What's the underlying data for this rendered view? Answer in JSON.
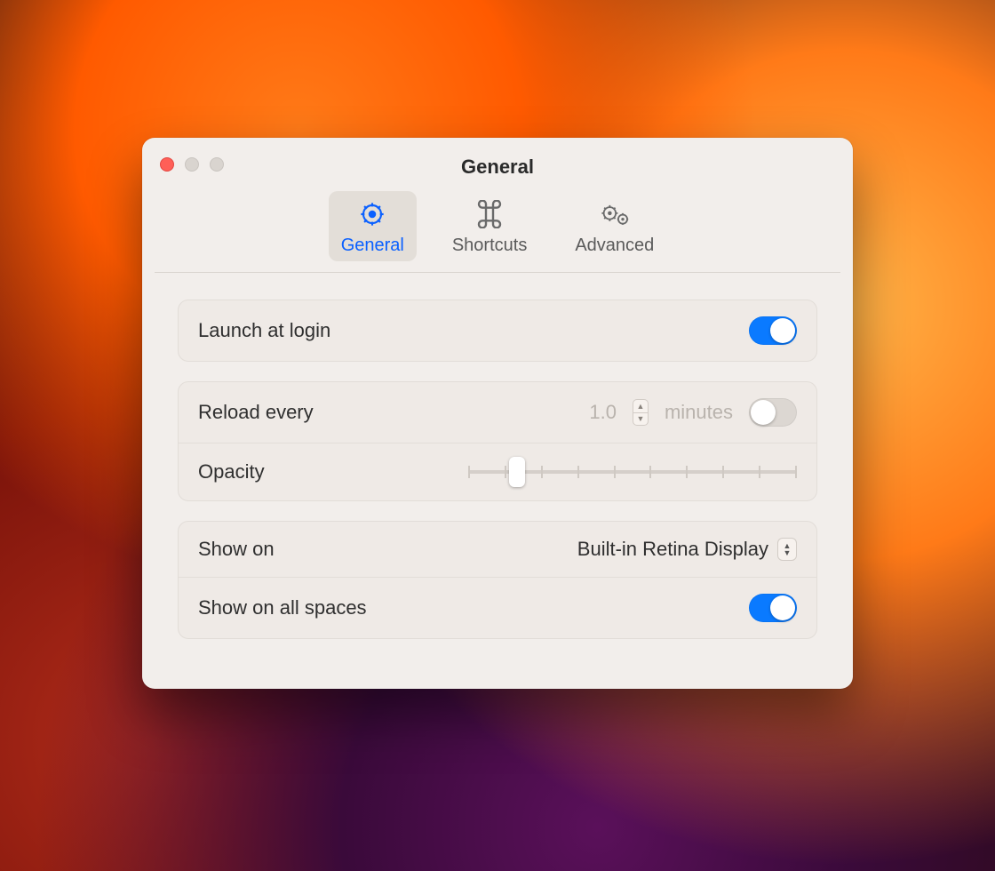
{
  "window": {
    "title": "General"
  },
  "tabs": [
    {
      "label": "General",
      "selected": true
    },
    {
      "label": "Shortcuts",
      "selected": false
    },
    {
      "label": "Advanced",
      "selected": false
    }
  ],
  "settings": {
    "launch_at_login": {
      "label": "Launch at login",
      "value": true
    },
    "reload": {
      "label": "Reload every",
      "interval": "1.0",
      "unit": "minutes",
      "enabled": false
    },
    "opacity": {
      "label": "Opacity",
      "value": 0.13,
      "ticks": 10
    },
    "show_on": {
      "label": "Show on",
      "value": "Built-in Retina Display"
    },
    "show_on_all_spaces": {
      "label": "Show on all spaces",
      "value": true
    }
  }
}
